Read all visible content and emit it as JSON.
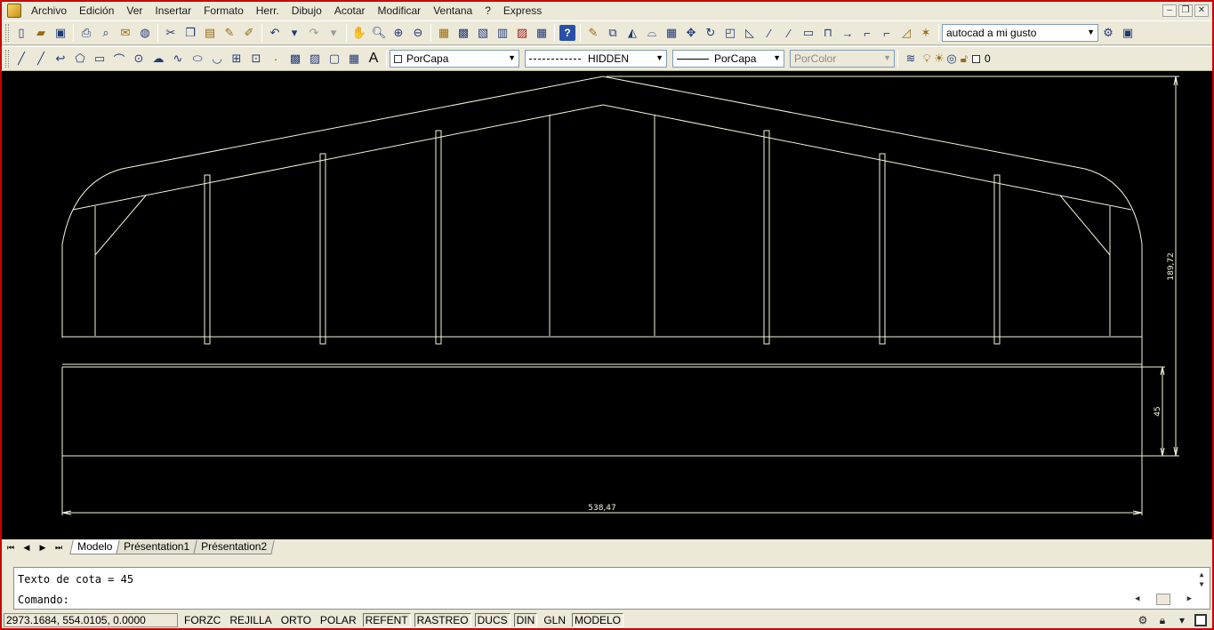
{
  "menu": {
    "items": [
      "Archivo",
      "Edición",
      "Ver",
      "Insertar",
      "Formato",
      "Herr.",
      "Dibujo",
      "Acotar",
      "Modificar",
      "Ventana",
      "?",
      "Express"
    ]
  },
  "toolbar_standard": {
    "workspace_value": "autocad a mi gusto"
  },
  "properties_toolbar": {
    "color_value": "PorCapa",
    "linetype_value": "HIDDEN",
    "lineweight_value": "PorCapa",
    "plotstyle_value": "PorColor",
    "layer_value": "0"
  },
  "drawing": {
    "dimension_width": "538,47",
    "dimension_total_height": "189,72",
    "dimension_base_height": "45",
    "line_color": "#f5f5dc",
    "background": "#000000"
  },
  "layout_tabs": [
    "Modelo",
    "Présentation1",
    "Présentation2"
  ],
  "command": {
    "history": "Texto de cota = 45",
    "prompt": "Comando:"
  },
  "status": {
    "coordinates": "2973.1684, 554.0105, 0.0000",
    "buttons": [
      "FORZC",
      "REJILLA",
      "ORTO",
      "POLAR",
      "REFENT",
      "RASTREO",
      "DUCS",
      "DIN",
      "GLN",
      "MODELO"
    ]
  }
}
